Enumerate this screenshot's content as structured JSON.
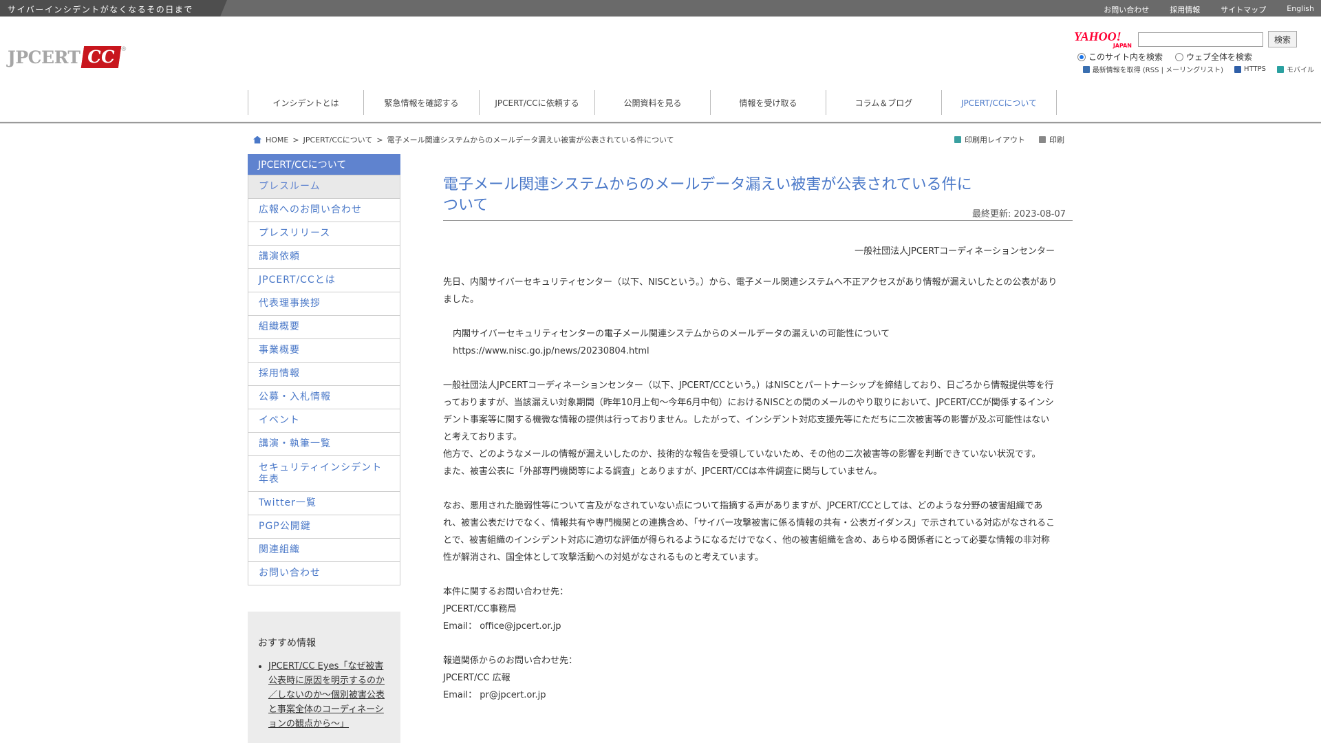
{
  "topbar": {
    "tagline": "サイバーインシデントがなくなるその日まで",
    "links": [
      "お問い合わせ",
      "採用情報",
      "サイトマップ",
      "English"
    ]
  },
  "logo": {
    "text_jp": "JPCERT",
    "text_cc": "CC",
    "reg": "®"
  },
  "search": {
    "yahoo_logo": "YAHOO!",
    "yahoo_sub": "JAPAN",
    "input_value": "",
    "button_label": "検索",
    "radio_site": "このサイト内を検索",
    "radio_web": "ウェブ全体を検索",
    "rss_label": "最新情報を取得 (RSS | メーリングリスト)",
    "https_label": "HTTPS",
    "mobile_label": "モバイル"
  },
  "mainnav": [
    "インシデントとは",
    "緊急情報を確認する",
    "JPCERT/CCに依頼する",
    "公開資料を見る",
    "情報を受け取る",
    "コラム＆ブログ",
    "JPCERT/CCについて"
  ],
  "breadcrumb": {
    "home": "HOME",
    "sep1": ">",
    "about": "JPCERT/CCについて",
    "sep2": ">",
    "current": "電子メール関連システムからのメールデータ漏えい被害が公表されている件について"
  },
  "print": {
    "layout": "印刷用レイアウト",
    "print": "印刷"
  },
  "sidebar": {
    "header": "JPCERT/CCについて",
    "items": [
      "プレスルーム",
      "広報へのお問い合わせ",
      "プレスリリース",
      "講演依頼",
      "JPCERT/CCとは",
      "代表理事挨拶",
      "組織概要",
      "事業概要",
      "採用情報",
      "公募・入札情報",
      "イベント",
      "講演・執筆一覧",
      "セキュリティインシデント年表",
      "Twitter一覧",
      "PGP公開鍵",
      "関連組織",
      "お問い合わせ"
    ]
  },
  "recommend": {
    "title": "おすすめ情報",
    "item1": "JPCERT/CC Eyes「なぜ被害公表時に原因を明示するのか／しないのか～個別被害公表と事案全体のコーディネーションの観点から～」"
  },
  "article": {
    "title": "電子メール関連システムからのメールデータ漏えい被害が公表されている件について",
    "updated": "最終更新: 2023-08-07",
    "org": "一般社団法人JPCERTコーディネーションセンター",
    "p1": "先日、内閣サイバーセキュリティセンター（以下、NISCという。）から、電子メール関連システムへ不正アクセスがあり情報が漏えいしたとの公表がありました。",
    "ref_title": "内閣サイバーセキュリティセンターの電子メール関連システムからのメールデータの漏えいの可能性について",
    "ref_url": "https://www.nisc.go.jp/news/20230804.html",
    "p2": "一般社団法人JPCERTコーディネーションセンター（以下、JPCERT/CCという。）はNISCとパートナーシップを締結しており、日ごろから情報提供等を行っておりますが、当該漏えい対象期間（昨年10月上旬～今年6月中旬）におけるNISCとの間のメールのやり取りにおいて、JPCERT/CCが関係するインシデント事案等に関する機微な情報の提供は行っておりません。したがって、インシデント対応支援先等にただちに二次被害等の影響が及ぶ可能性はないと考えております。",
    "p3": "他方で、どのようなメールの情報が漏えいしたのか、技術的な報告を受領していないため、その他の二次被害等の影響を判断できていない状況です。",
    "p4": "また、被害公表に「外部専門機関等による調査」とありますが、JPCERT/CCは本件調査に関与していません。",
    "p5": "なお、悪用された脆弱性等について言及がなされていない点について指摘する声がありますが、JPCERT/CCとしては、どのような分野の被害組織であれ、被害公表だけでなく、情報共有や専門機関との連携含め、「サイバー攻撃被害に係る情報の共有・公表ガイダンス」で示されている対応がなされることで、被害組織のインシデント対応に適切な評価が得られるようになるだけでなく、他の被害組織を含め、あらゆる関係者にとって必要な情報の非対称性が解消され、国全体として攻撃活動への対処がなされるものと考えています。",
    "contact1_label": "本件に関するお問い合わせ先：",
    "contact1_org": "JPCERT/CC事務局",
    "contact1_email": "Email： office@jpcert.or.jp",
    "contact2_label": "報道関係からのお問い合わせ先：",
    "contact2_org": "JPCERT/CC 広報",
    "contact2_email": "Email： pr@jpcert.or.jp"
  },
  "colors": {
    "accent": "#5f83cf",
    "link": "#4a78c8",
    "topbar": "#6a6a6a",
    "brand_red": "#c8161d"
  }
}
